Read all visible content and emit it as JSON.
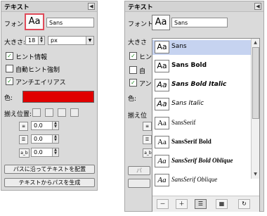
{
  "left_panel": {
    "title": "テキスト",
    "font_label": "フォント:",
    "font_preview": "Aa",
    "font_value": "Sans",
    "size_label": "大きさ:",
    "size_value": "18",
    "unit_value": "px",
    "hinting_label": "ヒント情報",
    "autohint_label": "自動ヒント強制",
    "antialias_label": "アンチエイリアス",
    "color_label": "色:",
    "justify_label": "揃え位置:",
    "indent_value": "0.0",
    "line_spacing_value": "0.0",
    "letter_spacing_value": "0.0",
    "letter_icon": "a_b",
    "path_button": "パスに沿ってテキストを配置",
    "create_path_button": "テキストからパスを生成"
  },
  "right_panel": {
    "title": "テキスト",
    "font_label": "フォント:",
    "font_preview": "Aa",
    "font_value": "Sans",
    "size_label": "大きさ",
    "hinting_label": "ヒン",
    "autohint_label": "自",
    "antialias_label": "アン",
    "color_label": "色:",
    "justify_label": "揃え位",
    "letter_icon": "a_b",
    "hidden_button_fragment": "パ",
    "font_list": [
      {
        "preview": "Aa",
        "name": "Sans",
        "selected": true
      },
      {
        "preview": "Aa",
        "name": "Sans Bold",
        "selected": false
      },
      {
        "preview": "Aa",
        "name": "Sans Bold Italic",
        "selected": false
      },
      {
        "preview": "Aa",
        "name": "Sans Italic",
        "selected": false
      },
      {
        "preview": "Aa",
        "name": "SansSerif",
        "selected": false
      },
      {
        "preview": "Aa",
        "name": "SansSerif Bold",
        "selected": false
      },
      {
        "preview": "Aa",
        "name": "SansSerif Bold Oblique",
        "selected": false
      },
      {
        "preview": "Aa",
        "name": "SansSerif Oblique",
        "selected": false
      }
    ],
    "toolbar": [
      "zoom-out-icon",
      "zoom-in-icon",
      "list-view-icon",
      "grid-view-icon",
      "refresh-icon"
    ]
  },
  "colors": {
    "text_color": "#e00000",
    "highlight": "#c6d3f0",
    "selected_border": "#e04b5a"
  }
}
